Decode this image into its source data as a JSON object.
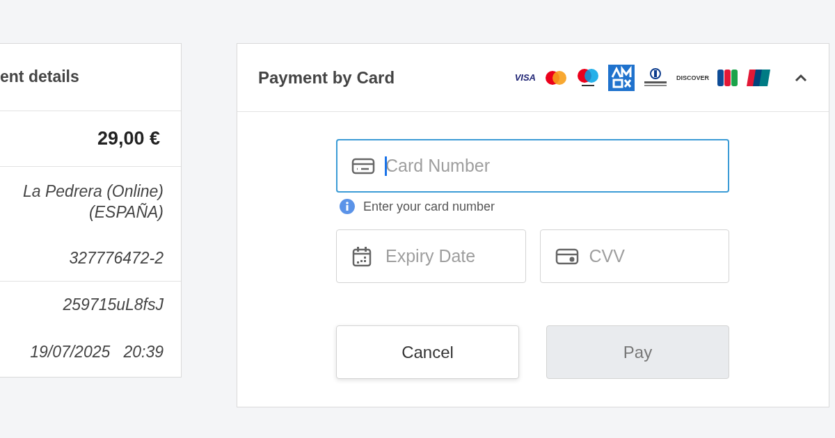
{
  "details": {
    "title": "ent details",
    "amount": "29,00 €",
    "groups": [
      {
        "lines": [
          "La Pedrera (Online)\n(ESPAÑA)",
          "327776472-2"
        ]
      },
      {
        "lines": [
          "259715uL8fsJ",
          "19/07/2025   20:39"
        ]
      }
    ]
  },
  "card_panel": {
    "title": "Payment by Card",
    "expanded": true,
    "brands": [
      {
        "kind": "visa",
        "label": "VISA"
      },
      {
        "kind": "mastercard"
      },
      {
        "kind": "maestro"
      },
      {
        "kind": "amex"
      },
      {
        "kind": "diners"
      },
      {
        "kind": "discover",
        "label": "DISCOVER"
      },
      {
        "kind": "jcb"
      },
      {
        "kind": "unionpay"
      }
    ],
    "fields": [
      {
        "kind": "card",
        "placeholder": "Card Number",
        "focused": true
      },
      {
        "kind": "calendar",
        "placeholder": "Expiry Date",
        "focused": false
      },
      {
        "kind": "cvv",
        "placeholder": "CVV",
        "focused": false
      }
    ],
    "hint": "Enter your card number",
    "buttons": [
      {
        "label": "Cancel",
        "disabled": false
      },
      {
        "label": "Pay",
        "disabled": true
      }
    ]
  }
}
